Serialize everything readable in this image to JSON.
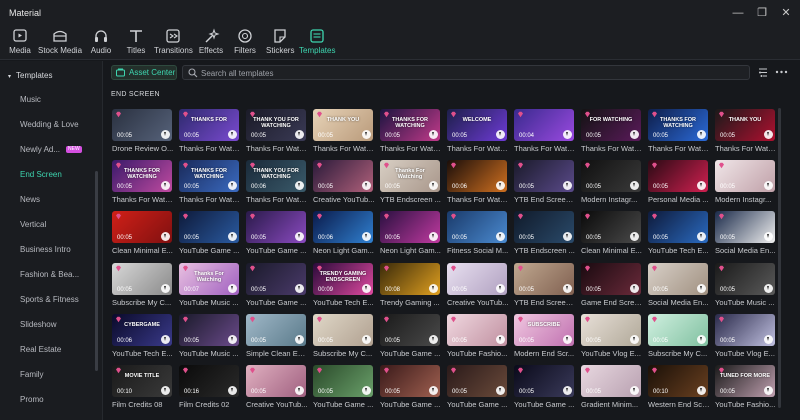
{
  "app": {
    "title": "Material"
  },
  "window_controls": {
    "minimize": "—",
    "maximize": "❐",
    "close": "✕"
  },
  "toolbar": {
    "items": [
      {
        "label": "Media",
        "icon": "media-icon"
      },
      {
        "label": "Stock Media",
        "icon": "stock-media-icon"
      },
      {
        "label": "Audio",
        "icon": "audio-icon"
      },
      {
        "label": "Titles",
        "icon": "titles-icon"
      },
      {
        "label": "Transitions",
        "icon": "transitions-icon"
      },
      {
        "label": "Effects",
        "icon": "effects-icon"
      },
      {
        "label": "Filters",
        "icon": "filters-icon"
      },
      {
        "label": "Stickers",
        "icon": "stickers-icon"
      },
      {
        "label": "Templates",
        "icon": "templates-icon",
        "active": true
      }
    ]
  },
  "sidebar": {
    "header": "Templates",
    "items": [
      {
        "label": "Music"
      },
      {
        "label": "Wedding & Love"
      },
      {
        "label": "Newly Ad...",
        "badge": "NEW"
      },
      {
        "label": "End Screen",
        "active": true
      },
      {
        "label": "News"
      },
      {
        "label": "Vertical"
      },
      {
        "label": "Business Intro"
      },
      {
        "label": "Fashion & Bea..."
      },
      {
        "label": "Sports & Fitness"
      },
      {
        "label": "Slideshow"
      },
      {
        "label": "Real Estate"
      },
      {
        "label": "Family"
      },
      {
        "label": "Promo"
      }
    ]
  },
  "asset_center": {
    "label": "Asset Center"
  },
  "search": {
    "placeholder": "Search all templates",
    "value": ""
  },
  "section": {
    "title": "END SCREEN"
  },
  "colors": {
    "accent": "#3ed6b0",
    "badge": "#d44fe0",
    "gem": "#e0508c"
  },
  "templates": [
    {
      "title": "Drone Review O...",
      "duration": "00:05",
      "thumb_text": "",
      "premium": true,
      "bg": [
        "#2a3140",
        "#56627a"
      ]
    },
    {
      "title": "Thanks For Watc...",
      "duration": "00:05",
      "thumb_text": "THANKS FOR",
      "premium": true,
      "bg": [
        "#2e2a6e",
        "#7a4ad0"
      ]
    },
    {
      "title": "Thanks For Watc...",
      "duration": "00:05",
      "thumb_text": "THANK YOU FOR WATCHING",
      "premium": true,
      "bg": [
        "#1b1b28",
        "#3a3a55"
      ]
    },
    {
      "title": "Thanks For Watc...",
      "duration": "00:05",
      "thumb_text": "THANK YOU",
      "premium": true,
      "bg": [
        "#e7d3b8",
        "#b99a7a"
      ]
    },
    {
      "title": "Thanks For Watc...",
      "duration": "00:05",
      "thumb_text": "THANKS FOR WATCHING",
      "premium": true,
      "bg": [
        "#1c1440",
        "#c23a8a"
      ]
    },
    {
      "title": "Thanks For Watc...",
      "duration": "00:05",
      "thumb_text": "WELCOME",
      "premium": true,
      "bg": [
        "#1d1f4a",
        "#6e3bd6"
      ]
    },
    {
      "title": "Thanks For Watc...",
      "duration": "00:04",
      "thumb_text": "",
      "premium": true,
      "bg": [
        "#3a2a8e",
        "#9a4ae0"
      ]
    },
    {
      "title": "Thanks For Watc...",
      "duration": "00:05",
      "thumb_text": "FOR WATCHING",
      "premium": true,
      "bg": [
        "#131313",
        "#5a1a5a"
      ]
    },
    {
      "title": "Thanks For Watc...",
      "duration": "00:05",
      "thumb_text": "THANKS FOR WATCHING",
      "premium": true,
      "bg": [
        "#0e1e4a",
        "#2b6ad8"
      ]
    },
    {
      "title": "Thanks For Watc...",
      "duration": "00:05",
      "thumb_text": "THANK YOU",
      "premium": true,
      "bg": [
        "#1a1a1a",
        "#b01030"
      ]
    },
    {
      "title": "Thanks For Watc...",
      "duration": "00:05",
      "thumb_text": "THANKS FOR WATCHING",
      "premium": true,
      "bg": [
        "#3a1a6a",
        "#c04aa0"
      ]
    },
    {
      "title": "Thanks For Watc...",
      "duration": "00:05",
      "thumb_text": "THANKS FOR WATCHING",
      "premium": true,
      "bg": [
        "#1a2a5a",
        "#3a6ac0"
      ]
    },
    {
      "title": "Thanks For Watc...",
      "duration": "00:06",
      "thumb_text": "THANK YOU FOR WATCHING",
      "premium": true,
      "bg": [
        "#1a2a3a",
        "#3a5a6a"
      ]
    },
    {
      "title": "Creative YouTub...",
      "duration": "00:05",
      "thumb_text": "",
      "premium": true,
      "bg": [
        "#2a1a3a",
        "#b0607a"
      ]
    },
    {
      "title": "YTB Endscreen ...",
      "duration": "00:05",
      "thumb_text": "Thanks For Watching",
      "premium": true,
      "bg": [
        "#d8cfc4",
        "#a8968a"
      ]
    },
    {
      "title": "Thanks For Watc...",
      "duration": "00:06",
      "thumb_text": "",
      "premium": true,
      "bg": [
        "#1a0e0a",
        "#d07020"
      ]
    },
    {
      "title": "YTB End Screen ...",
      "duration": "00:05",
      "thumb_text": "",
      "premium": true,
      "bg": [
        "#1a1a2a",
        "#5a4a8a"
      ]
    },
    {
      "title": "Modern Instagr...",
      "duration": "00:05",
      "thumb_text": "",
      "premium": true,
      "bg": [
        "#101010",
        "#3a3a3a"
      ]
    },
    {
      "title": "Personal Media ...",
      "duration": "00:05",
      "thumb_text": "",
      "premium": true,
      "bg": [
        "#2a0a14",
        "#d02050"
      ]
    },
    {
      "title": "Modern Instagr...",
      "duration": "00:05",
      "thumb_text": "",
      "premium": true,
      "bg": [
        "#f0e6e8",
        "#c0a0a8"
      ]
    },
    {
      "title": "Clean Minimal E...",
      "duration": "00:05",
      "thumb_text": "",
      "premium": true,
      "bg": [
        "#d02018",
        "#801010"
      ]
    },
    {
      "title": "YouTube Game ...",
      "duration": "00:05",
      "thumb_text": "",
      "premium": true,
      "bg": [
        "#0e1a3a",
        "#2a5aa0"
      ]
    },
    {
      "title": "YouTube Game ...",
      "duration": "00:05",
      "thumb_text": "",
      "premium": true,
      "bg": [
        "#2a1a4a",
        "#8a4ac0"
      ]
    },
    {
      "title": "Neon Light Gam...",
      "duration": "00:06",
      "thumb_text": "",
      "premium": true,
      "bg": [
        "#0a1a4a",
        "#3080d0"
      ]
    },
    {
      "title": "Neon Light Gam...",
      "duration": "00:05",
      "thumb_text": "",
      "premium": true,
      "bg": [
        "#2a1040",
        "#c03aa0"
      ]
    },
    {
      "title": "Fitness Social M...",
      "duration": "00:05",
      "thumb_text": "",
      "premium": true,
      "bg": [
        "#1a3a6a",
        "#4a8ad0"
      ]
    },
    {
      "title": "YTB Endscreen ...",
      "duration": "00:05",
      "thumb_text": "",
      "premium": true,
      "bg": [
        "#101a2a",
        "#2a4a6a"
      ]
    },
    {
      "title": "Clean Minimal E...",
      "duration": "00:05",
      "thumb_text": "",
      "premium": true,
      "bg": [
        "#0a0a0a",
        "#4a4a4a"
      ]
    },
    {
      "title": "YouTube Tech E...",
      "duration": "00:05",
      "thumb_text": "",
      "premium": true,
      "bg": [
        "#0e1a3a",
        "#2a6ac0"
      ]
    },
    {
      "title": "Social Media En...",
      "duration": "00:05",
      "thumb_text": "",
      "premium": true,
      "bg": [
        "#1a2a4a",
        "#f0f0f0"
      ]
    },
    {
      "title": "Subscribe My C...",
      "duration": "00:05",
      "thumb_text": "",
      "premium": true,
      "bg": [
        "#d8d8d8",
        "#8a8a8a"
      ]
    },
    {
      "title": "YouTube Music ...",
      "duration": "00:07",
      "thumb_text": "Thanks For Watching",
      "premium": true,
      "bg": [
        "#e8c0e0",
        "#a060c0"
      ]
    },
    {
      "title": "YouTube Game ...",
      "duration": "00:05",
      "thumb_text": "",
      "premium": true,
      "bg": [
        "#1a1a2a",
        "#4a3a6a"
      ]
    },
    {
      "title": "YouTube Tech E...",
      "duration": "00:09",
      "thumb_text": "TRENDY GAMING ENDSCREEN",
      "premium": true,
      "bg": [
        "#2a0a3a",
        "#e04aa0"
      ]
    },
    {
      "title": "Trendy Gaming ...",
      "duration": "00:08",
      "thumb_text": "",
      "premium": true,
      "bg": [
        "#3a2a0a",
        "#e0a020"
      ]
    },
    {
      "title": "Creative YouTub...",
      "duration": "00:05",
      "thumb_text": "",
      "premium": true,
      "bg": [
        "#e8e0f0",
        "#b0a0c0"
      ]
    },
    {
      "title": "YTB End Screen ...",
      "duration": "00:05",
      "thumb_text": "",
      "premium": true,
      "bg": [
        "#c0a890",
        "#806050"
      ]
    },
    {
      "title": "Game End Scree...",
      "duration": "00:05",
      "thumb_text": "",
      "premium": true,
      "bg": [
        "#1a0a10",
        "#6a2a3a"
      ]
    },
    {
      "title": "Social Media En...",
      "duration": "00:05",
      "thumb_text": "",
      "premium": true,
      "bg": [
        "#d8d0c8",
        "#a09080"
      ]
    },
    {
      "title": "YouTube Music ...",
      "duration": "00:05",
      "thumb_text": "",
      "premium": true,
      "bg": [
        "#1a1a1a",
        "#5a5a5a"
      ]
    },
    {
      "title": "YouTube Tech E...",
      "duration": "00:06",
      "thumb_text": "CYBERGAME",
      "premium": true,
      "bg": [
        "#0a0a2a",
        "#3a3a8a"
      ]
    },
    {
      "title": "YouTube Music ...",
      "duration": "00:05",
      "thumb_text": "",
      "premium": true,
      "bg": [
        "#1a1a2a",
        "#6a4a8a"
      ]
    },
    {
      "title": "Simple Clean En...",
      "duration": "00:05",
      "thumb_text": "",
      "premium": true,
      "bg": [
        "#a0b8c8",
        "#5a7a8a"
      ]
    },
    {
      "title": "Subscribe My C...",
      "duration": "00:05",
      "thumb_text": "",
      "premium": true,
      "bg": [
        "#e0d8c8",
        "#b0a090"
      ]
    },
    {
      "title": "YouTube Game ...",
      "duration": "00:05",
      "thumb_text": "",
      "premium": true,
      "bg": [
        "#1a1a1a",
        "#4a4a4a"
      ]
    },
    {
      "title": "YouTube Fashio...",
      "duration": "00:05",
      "thumb_text": "",
      "premium": true,
      "bg": [
        "#f0d8e0",
        "#c090a0"
      ]
    },
    {
      "title": "Modern End Scr...",
      "duration": "00:05",
      "thumb_text": "SUBSCRIBE",
      "premium": true,
      "bg": [
        "#f0c8e0",
        "#c070b0"
      ]
    },
    {
      "title": "YouTube Vlog E...",
      "duration": "00:05",
      "thumb_text": "",
      "premium": true,
      "bg": [
        "#e8e0d8",
        "#b0a898"
      ]
    },
    {
      "title": "Subscribe My C...",
      "duration": "00:05",
      "thumb_text": "",
      "premium": true,
      "bg": [
        "#d0f0e0",
        "#80c0a0"
      ]
    },
    {
      "title": "YouTube Vlog E...",
      "duration": "00:05",
      "thumb_text": "",
      "premium": true,
      "bg": [
        "#2a2a4a",
        "#c0c0e0"
      ]
    },
    {
      "title": "Film Credits 08",
      "duration": "00:10",
      "thumb_text": "MOVIE TITLE",
      "premium": true,
      "bg": [
        "#1a1a1a",
        "#3a3a3a"
      ]
    },
    {
      "title": "Film Credits 02",
      "duration": "00:16",
      "thumb_text": "",
      "premium": true,
      "bg": [
        "#0a0a0a",
        "#2a2a2a"
      ]
    },
    {
      "title": "Creative YouTub...",
      "duration": "00:05",
      "thumb_text": "",
      "premium": true,
      "bg": [
        "#e0b0c0",
        "#a06080"
      ]
    },
    {
      "title": "YouTube Game ...",
      "duration": "00:05",
      "thumb_text": "",
      "premium": true,
      "bg": [
        "#2a4a2a",
        "#6aa06a"
      ]
    },
    {
      "title": "YouTube Game ...",
      "duration": "00:05",
      "thumb_text": "",
      "premium": true,
      "bg": [
        "#3a1a1a",
        "#a06050"
      ]
    },
    {
      "title": "YouTube Game ...",
      "duration": "00:05",
      "thumb_text": "",
      "premium": true,
      "bg": [
        "#2a1a1a",
        "#6a4a3a"
      ]
    },
    {
      "title": "YouTube Game ...",
      "duration": "00:05",
      "thumb_text": "",
      "premium": true,
      "bg": [
        "#0a0a1a",
        "#3a3a5a"
      ]
    },
    {
      "title": "Gradient Minim...",
      "duration": "00:05",
      "thumb_text": "",
      "premium": true,
      "bg": [
        "#e8d8e0",
        "#b8a0b0"
      ]
    },
    {
      "title": "Western End Scr...",
      "duration": "00:10",
      "thumb_text": "",
      "premium": true,
      "bg": [
        "#1a1008",
        "#6a4020"
      ]
    },
    {
      "title": "YouTube Fashio...",
      "duration": "00:05",
      "thumb_text": "TUNED FOR MORE",
      "premium": true,
      "bg": [
        "#1a1a1a",
        "#c0a0b0"
      ]
    }
  ]
}
